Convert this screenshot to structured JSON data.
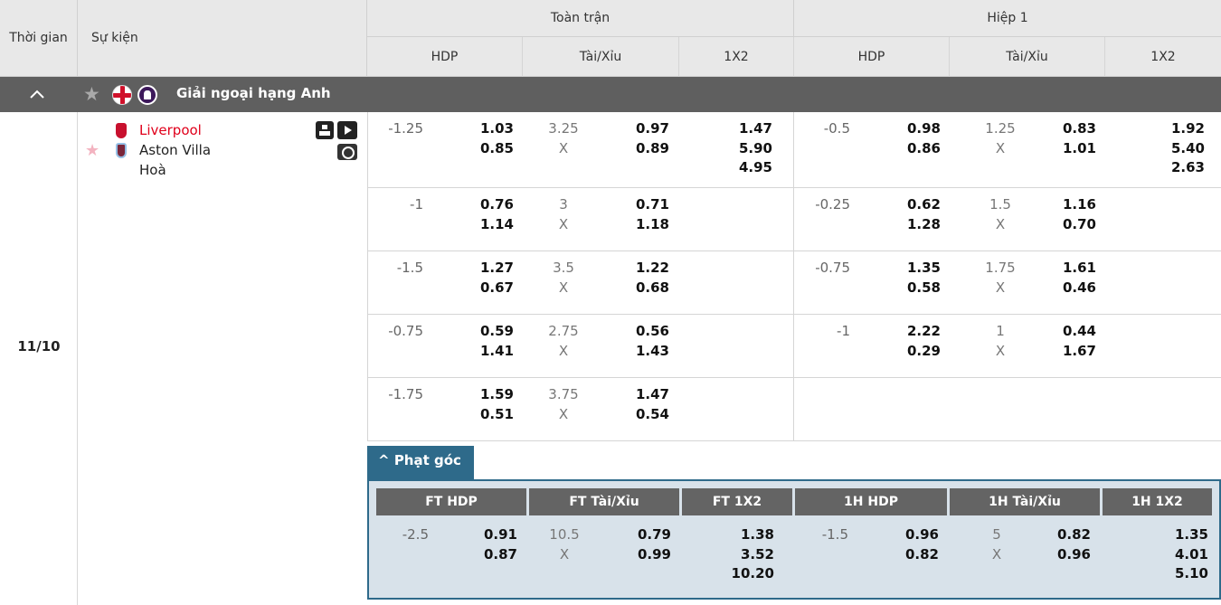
{
  "header": {
    "time": "Thời gian",
    "event": "Sự kiện",
    "full_time": "Toàn trận",
    "half1": "Hiệp 1",
    "sub": [
      "HDP",
      "Tài/Xỉu",
      "1X2",
      "HDP",
      "Tài/Xỉu",
      "1X2"
    ]
  },
  "league": {
    "name": "Giải ngoại hạng Anh"
  },
  "match": {
    "date": "11/10",
    "home": "Liverpool",
    "away": "Aston Villa",
    "draw": "Hoà"
  },
  "rows": [
    {
      "ft_hdp": "-1.25",
      "ft_hdp_h": "1.03",
      "ft_hdp_a": "0.85",
      "ft_ou": "3.25",
      "ft_ou_x": "X",
      "ft_ou_o": "0.97",
      "ft_ou_u": "0.89",
      "ft_1": "1.47",
      "ft_2": "5.90",
      "ft_x": "4.95",
      "h1_hdp": "-0.5",
      "h1_hdp_h": "0.98",
      "h1_hdp_a": "0.86",
      "h1_ou": "1.25",
      "h1_ou_x": "X",
      "h1_ou_o": "0.83",
      "h1_ou_u": "1.01",
      "h1_1": "1.92",
      "h1_2": "5.40",
      "h1_x": "2.63"
    },
    {
      "ft_hdp": "-1",
      "ft_hdp_h": "0.76",
      "ft_hdp_a": "1.14",
      "ft_ou": "3",
      "ft_ou_x": "X",
      "ft_ou_o": "0.71",
      "ft_ou_u": "1.18",
      "h1_hdp": "-0.25",
      "h1_hdp_h": "0.62",
      "h1_hdp_a": "1.28",
      "h1_ou": "1.5",
      "h1_ou_x": "X",
      "h1_ou_o": "1.16",
      "h1_ou_u": "0.70"
    },
    {
      "ft_hdp": "-1.5",
      "ft_hdp_h": "1.27",
      "ft_hdp_a": "0.67",
      "ft_ou": "3.5",
      "ft_ou_x": "X",
      "ft_ou_o": "1.22",
      "ft_ou_u": "0.68",
      "h1_hdp": "-0.75",
      "h1_hdp_h": "1.35",
      "h1_hdp_a": "0.58",
      "h1_ou": "1.75",
      "h1_ou_x": "X",
      "h1_ou_o": "1.61",
      "h1_ou_u": "0.46"
    },
    {
      "ft_hdp": "-0.75",
      "ft_hdp_h": "0.59",
      "ft_hdp_a": "1.41",
      "ft_ou": "2.75",
      "ft_ou_x": "X",
      "ft_ou_o": "0.56",
      "ft_ou_u": "1.43",
      "h1_hdp": "-1",
      "h1_hdp_h": "2.22",
      "h1_hdp_a": "0.29",
      "h1_ou": "1",
      "h1_ou_x": "X",
      "h1_ou_o": "0.44",
      "h1_ou_u": "1.67"
    },
    {
      "ft_hdp": "-1.75",
      "ft_hdp_h": "1.59",
      "ft_hdp_a": "0.51",
      "ft_ou": "3.75",
      "ft_ou_x": "X",
      "ft_ou_o": "1.47",
      "ft_ou_u": "0.54"
    }
  ],
  "corners": {
    "tab": "Phạt góc",
    "headers": [
      "FT HDP",
      "FT Tài/Xỉu",
      "FT 1X2",
      "1H HDP",
      "1H Tài/Xỉu",
      "1H 1X2"
    ],
    "ft_hdp": "-2.5",
    "ft_hdp_h": "0.91",
    "ft_hdp_a": "0.87",
    "ft_ou": "10.5",
    "ft_ou_x": "X",
    "ft_ou_o": "0.79",
    "ft_ou_u": "0.99",
    "ft_1": "1.38",
    "ft_2": "3.52",
    "ft_x": "10.20",
    "h1_hdp": "-1.5",
    "h1_hdp_h": "0.96",
    "h1_hdp_a": "0.82",
    "h1_ou": "5",
    "h1_ou_x": "X",
    "h1_ou_o": "0.82",
    "h1_ou_u": "0.96",
    "h1_1": "1.35",
    "h1_2": "4.01",
    "h1_x": "5.10"
  },
  "colors": {
    "league_bar": "#5f5f5f",
    "home_team": "#e0001b",
    "corner_accent": "#2e6a8a"
  }
}
